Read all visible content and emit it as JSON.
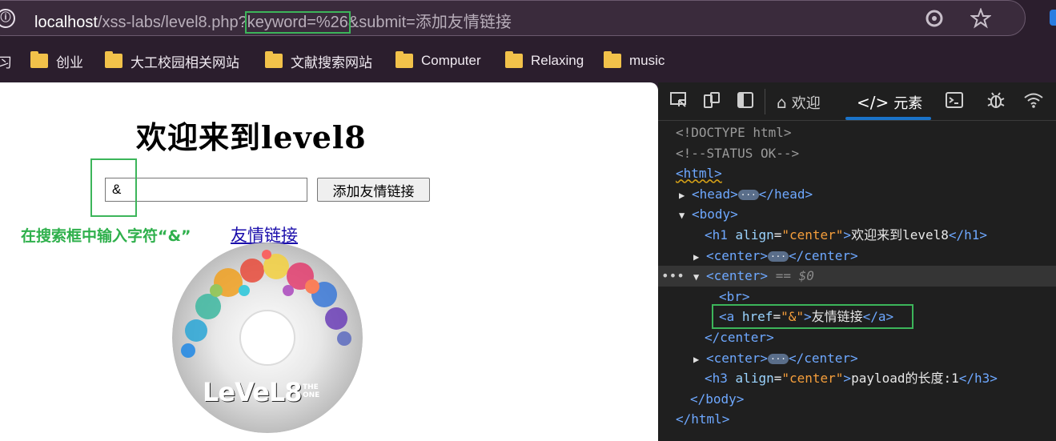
{
  "browser": {
    "url_host": "localhost",
    "url_path": "/xss-labs/level8.php?",
    "url_param": "keyword=%26",
    "url_rest": "&submit=添加友情链接",
    "info_icon": "ⓘ",
    "bookmarks": [
      {
        "label": "习",
        "folder": false
      },
      {
        "label": "创业",
        "folder": true
      },
      {
        "label": "大工校园相关网站",
        "folder": true
      },
      {
        "label": "文献搜索网站",
        "folder": true
      },
      {
        "label": "Computer",
        "folder": true
      },
      {
        "label": "Relaxing",
        "folder": true
      },
      {
        "label": "music",
        "folder": true
      }
    ]
  },
  "page": {
    "title": "欢迎来到level8",
    "input_value": "&",
    "submit_label": "添加友情链接",
    "note": "在搜索框中输入字符“&”",
    "link_text": "友情链接",
    "cd_text": "LeVeL8",
    "cd_sub": "THE\nONE"
  },
  "devtools": {
    "tabs": {
      "welcome": "欢迎",
      "elements": "元素"
    },
    "dom": {
      "doctype": "<!DOCTYPE html>",
      "comment": "<!--STATUS OK-->",
      "html_open": "<html>",
      "head_open": "<head>",
      "head_close": "</head>",
      "body_open": "<body>",
      "h1_open": "<h1",
      "h1_attr": "align",
      "h1_val": "\"center\"",
      "h1_text": "欢迎来到level8",
      "h1_close": "</h1>",
      "center_open": "<center>",
      "center_close": "</center>",
      "selected_marker": "== $0",
      "br": "<br>",
      "a_open": "<a",
      "a_attr": "href",
      "a_val": "\"&\"",
      "a_text": "友情链接",
      "a_close": "</a>",
      "h3_open": "<h3",
      "h3_attr": "align",
      "h3_val": "\"center\"",
      "h3_text": "payload的长度:1",
      "h3_close": "</h3>",
      "body_close": "</body>",
      "html_close": "</html>",
      "ellipsis": "···"
    }
  },
  "colors": {
    "highlight_green": "#3cb55a",
    "link_blue": "#1a0dab",
    "tab_accent": "#1a73c9"
  }
}
